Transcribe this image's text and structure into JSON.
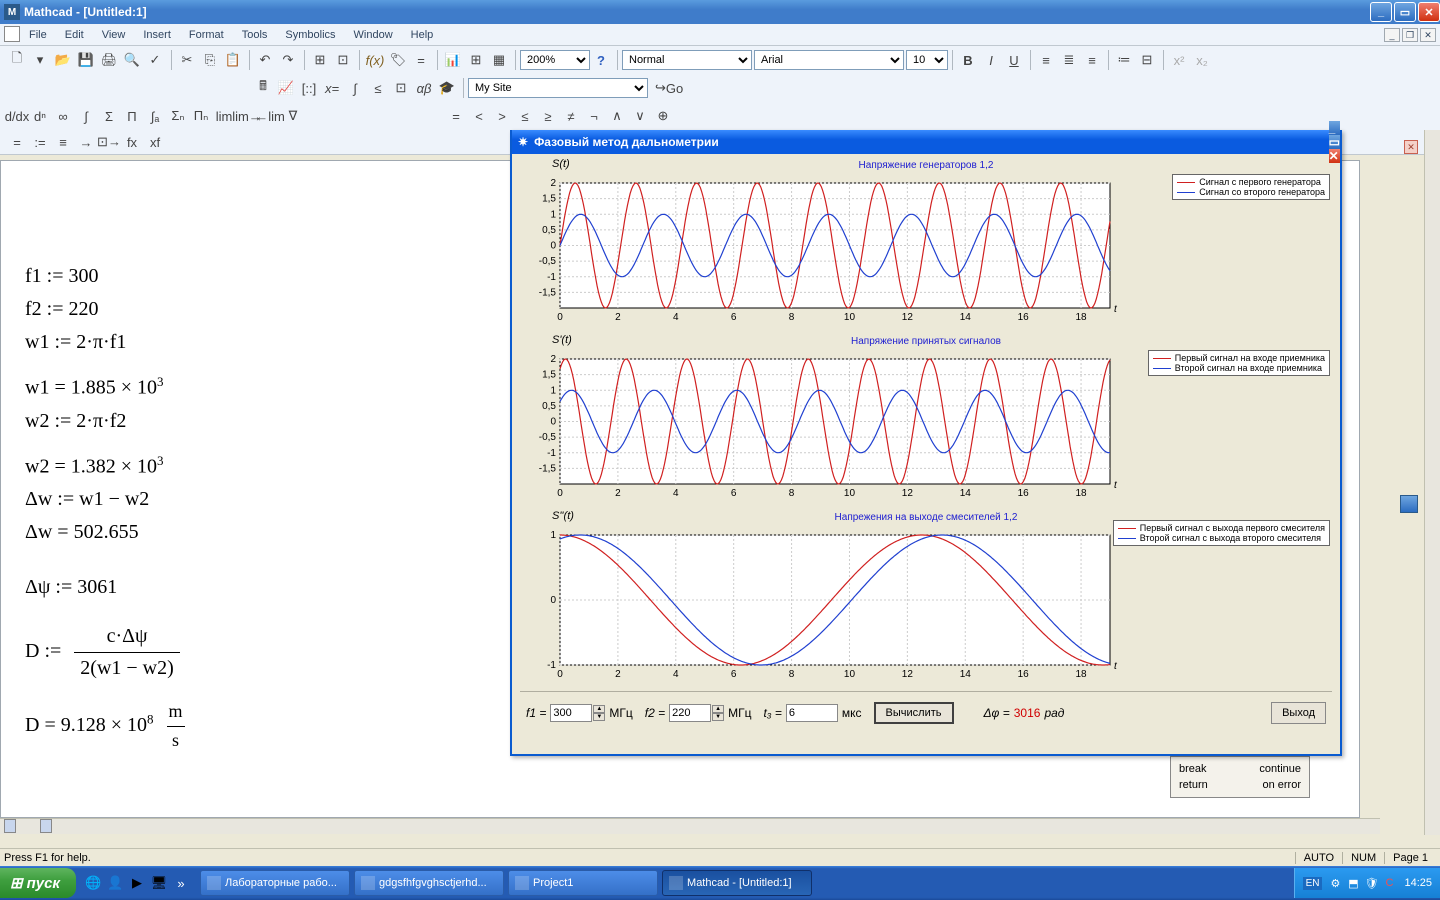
{
  "title": "Mathcad - [Untitled:1]",
  "menu": [
    "File",
    "Edit",
    "View",
    "Insert",
    "Format",
    "Tools",
    "Symbolics",
    "Window",
    "Help"
  ],
  "zoom": "200%",
  "style_sel": "Normal",
  "font_sel": "Arial",
  "size_sel": "10",
  "mysite": "My Site",
  "go": "Go",
  "worksheet": {
    "l1": "f1 := 300",
    "l2": "f2 := 220",
    "l3": "w1 := 2·π·f1",
    "l4a": "w1 = 1.885 × 10",
    "l4e": "3",
    "l5": "w2 := 2·π·f2",
    "l6a": "w2 = 1.382 × 10",
    "l6e": "3",
    "l7": "Δw := w1 − w2",
    "l8": "Δw = 502.655",
    "l9": "Δψ := 3061",
    "l10a": "D := ",
    "l10n": "c·Δψ",
    "l10d": "2(w1 − w2)",
    "l11a": "D = 9.128 × 10",
    "l11e": "8",
    "l11u_n": "m",
    "l11u_d": "s"
  },
  "app": {
    "title": "Фазовый метод дальнометрии",
    "plot1": {
      "title": "Напряжение генераторов 1,2",
      "ylabel": "S(t)",
      "xend": "t",
      "leg1": "Сигнал с первого генератора",
      "leg2": "Сигнал со второго генератора"
    },
    "plot2": {
      "title": "Напряжение принятых сигналов",
      "ylabel": "S'(t)",
      "xend": "t",
      "leg1": "Первый сигнал на входе приемника",
      "leg2": "Второй сигнал на входе приемника"
    },
    "plot3": {
      "title": "Напрежения на выходе смесителей 1,2",
      "ylabel": "S''(t)",
      "xend": "t",
      "leg1": "Первый сигнал с выхода первого смесителя",
      "leg2": "Второй сигнал с выхода второго смесителя"
    },
    "f1_label": "f1 =",
    "f1_val": "300",
    "f1_unit": "МГц",
    "f2_label": "f2 =",
    "f2_val": "220",
    "f2_unit": "МГц",
    "tz_label": "t₃ =",
    "tz_val": "6",
    "tz_unit": "мкс",
    "calc": "Вычислить",
    "dphi_label": "Δφ =",
    "dphi_val": "3016",
    "dphi_unit": "рад",
    "exit": "Выход"
  },
  "chart_data": [
    {
      "type": "line",
      "title": "Напряжение генераторов 1,2",
      "xlabel": "t",
      "ylabel": "S(t)",
      "xlim": [
        0,
        19
      ],
      "ylim": [
        -2,
        2
      ],
      "xticks": [
        0,
        2,
        4,
        6,
        8,
        10,
        12,
        14,
        16,
        18
      ],
      "yticks": [
        -1.5,
        -1,
        -0.5,
        0,
        0.5,
        1,
        1.5,
        2
      ],
      "series": [
        {
          "name": "Сигнал с первого генератора",
          "color": "#d02020",
          "formula": "2*sin(2*pi*0.477*t)"
        },
        {
          "name": "Сигнал со второго генератора",
          "color": "#2040d0",
          "formula": "1*sin(2*pi*0.35*t)"
        }
      ]
    },
    {
      "type": "line",
      "title": "Напряжение принятых сигналов",
      "xlabel": "t",
      "ylabel": "S'(t)",
      "xlim": [
        0,
        19
      ],
      "ylim": [
        -2,
        2
      ],
      "xticks": [
        0,
        2,
        4,
        6,
        8,
        10,
        12,
        14,
        16,
        18
      ],
      "yticks": [
        -1.5,
        -1,
        -0.5,
        0,
        0.5,
        1,
        1.5,
        2
      ],
      "series": [
        {
          "name": "Первый сигнал на входе приемника",
          "color": "#d02020",
          "formula": "2*sin(2*pi*0.477*t + 1.0)"
        },
        {
          "name": "Второй сигнал на входе приемника",
          "color": "#2040d0",
          "formula": "1*sin(2*pi*0.35*t + 0.7)"
        }
      ]
    },
    {
      "type": "line",
      "title": "Напрежения на выходе смесителей 1,2",
      "xlabel": "t",
      "ylabel": "S''(t)",
      "xlim": [
        0,
        19
      ],
      "ylim": [
        -1,
        1
      ],
      "xticks": [
        0,
        2,
        4,
        6,
        8,
        10,
        12,
        14,
        16,
        18
      ],
      "yticks": [
        -1,
        0,
        1
      ],
      "series": [
        {
          "name": "Первый сигнал с выхода первого смесителя",
          "color": "#d02020",
          "formula": "cos(2*pi*0.08*t)"
        },
        {
          "name": "Второй сигнал с выхода второго смесителя",
          "color": "#2040d0",
          "formula": "cos(2*pi*0.08*t - 0.35)"
        }
      ]
    }
  ],
  "prog_pal": {
    "break": "break",
    "continue": "continue",
    "return": "return",
    "onerror": "on error"
  },
  "status": {
    "help": "Press F1 for help.",
    "auto": "AUTO",
    "num": "NUM",
    "page": "Page 1"
  },
  "taskbar": {
    "start": "пуск",
    "tasks": [
      {
        "label": "Лабораторные рабо..."
      },
      {
        "label": "gdgsfhfgvghsctjerhd..."
      },
      {
        "label": "Project1"
      },
      {
        "label": "Mathcad - [Untitled:1]",
        "active": true
      }
    ],
    "lang": "EN",
    "time": "14:25"
  }
}
